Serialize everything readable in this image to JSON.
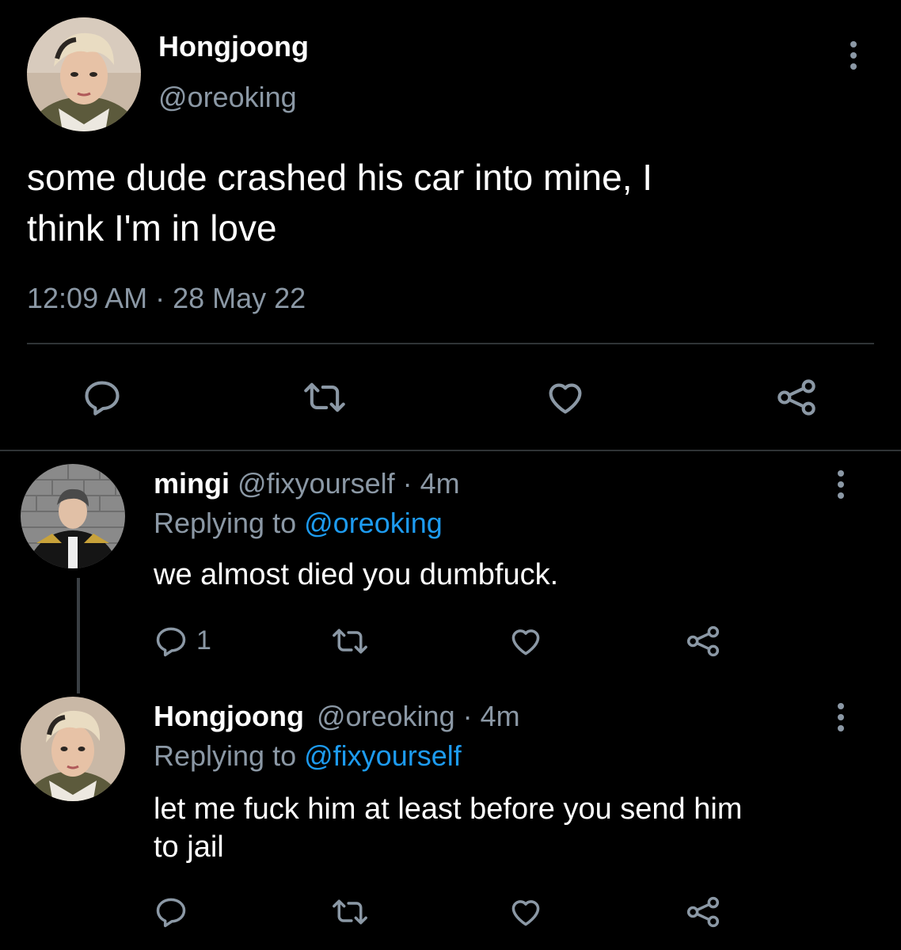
{
  "colors": {
    "background": "#000000",
    "text": "#ffffff",
    "muted": "#8b98a5",
    "link": "#1d9bf0",
    "divider": "#2f3336"
  },
  "main_tweet": {
    "author_name": "Hongjoong",
    "author_handle": "@oreoking",
    "text_line1": "some dude crashed his car into mine, I",
    "text_line2": "think I'm in love",
    "timestamp": "12:09 AM · 28 May 22",
    "menu_icon": "more-vertical-icon",
    "actions": [
      "reply-icon",
      "retweet-icon",
      "like-icon",
      "share-icon"
    ]
  },
  "replies": [
    {
      "author_name": "mingi",
      "author_handle": "@fixyourself",
      "time": "· 4m",
      "replying_label": "Replying to",
      "replying_handle": "@oreoking",
      "text": "we almost died you dumbfuck.",
      "reply_count": "1"
    },
    {
      "author_name": "Hongjoong",
      "author_handle": "@oreoking",
      "time": "· 4m",
      "replying_label": "Replying to",
      "replying_handle": "@fixyourself",
      "text_line1": "let me fuck him at least before you send him",
      "text_line2": "to jail",
      "reply_count": ""
    }
  ]
}
